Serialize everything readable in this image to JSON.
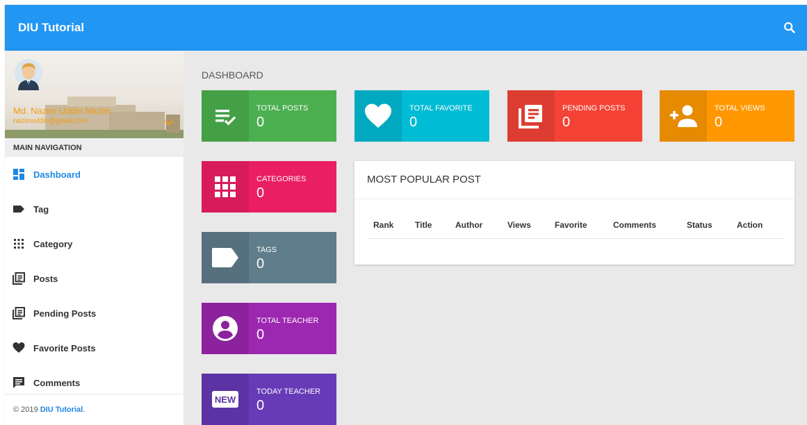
{
  "topbar": {
    "brand": "DIU Tutorial",
    "search_icon": "search-icon",
    "color": "#2196f3"
  },
  "sidebar": {
    "user": {
      "name": "Md. Nazim Uddin Nazim",
      "email": "nazimuddin@gmail.com"
    },
    "header": "MAIN NAVIGATION",
    "items": [
      {
        "label": "Dashboard",
        "icon": "dashboard-icon"
      },
      {
        "label": "Tag",
        "icon": "tag-icon"
      },
      {
        "label": "Category",
        "icon": "grid-icon"
      },
      {
        "label": "Posts",
        "icon": "library-books-icon"
      },
      {
        "label": "Pending Posts",
        "icon": "library-books-icon"
      },
      {
        "label": "Favorite Posts",
        "icon": "heart-icon"
      },
      {
        "label": "Comments",
        "icon": "comment-icon"
      }
    ],
    "footer": {
      "year": "© 2019",
      "link": "DIU Tutorial",
      "period": "."
    }
  },
  "main": {
    "title": "DASHBOARD",
    "cards": [
      {
        "label": "TOTAL POSTS",
        "value": "0",
        "icon": "playlist-check-icon",
        "color": "#4caf50"
      },
      {
        "label": "TOTAL FAVORITE",
        "value": "0",
        "icon": "heart-icon",
        "color": "#00bcd4"
      },
      {
        "label": "PENDING POSTS",
        "value": "0",
        "icon": "library-books-icon",
        "color": "#f44336"
      },
      {
        "label": "TOTAL VIEWS",
        "value": "0",
        "icon": "person-add-icon",
        "color": "#ff9800"
      },
      {
        "label": "CATEGORIES",
        "value": "0",
        "icon": "grid-icon",
        "color": "#e91e63"
      },
      {
        "label": "TAGS",
        "value": "0",
        "icon": "tag-icon",
        "color": "#607d8b"
      },
      {
        "label": "TOTAL TEACHER",
        "value": "0",
        "icon": "account-circle-icon",
        "color": "#9c27b0"
      },
      {
        "label": "TODAY TEACHER",
        "value": "0",
        "icon": "new-badge-icon",
        "badge": "NEW",
        "color": "#673ab7"
      }
    ],
    "popular": {
      "title": "MOST POPULAR POST",
      "columns": [
        "Rank",
        "Title",
        "Author",
        "Views",
        "Favorite",
        "Comments",
        "Status",
        "Action"
      ]
    }
  }
}
